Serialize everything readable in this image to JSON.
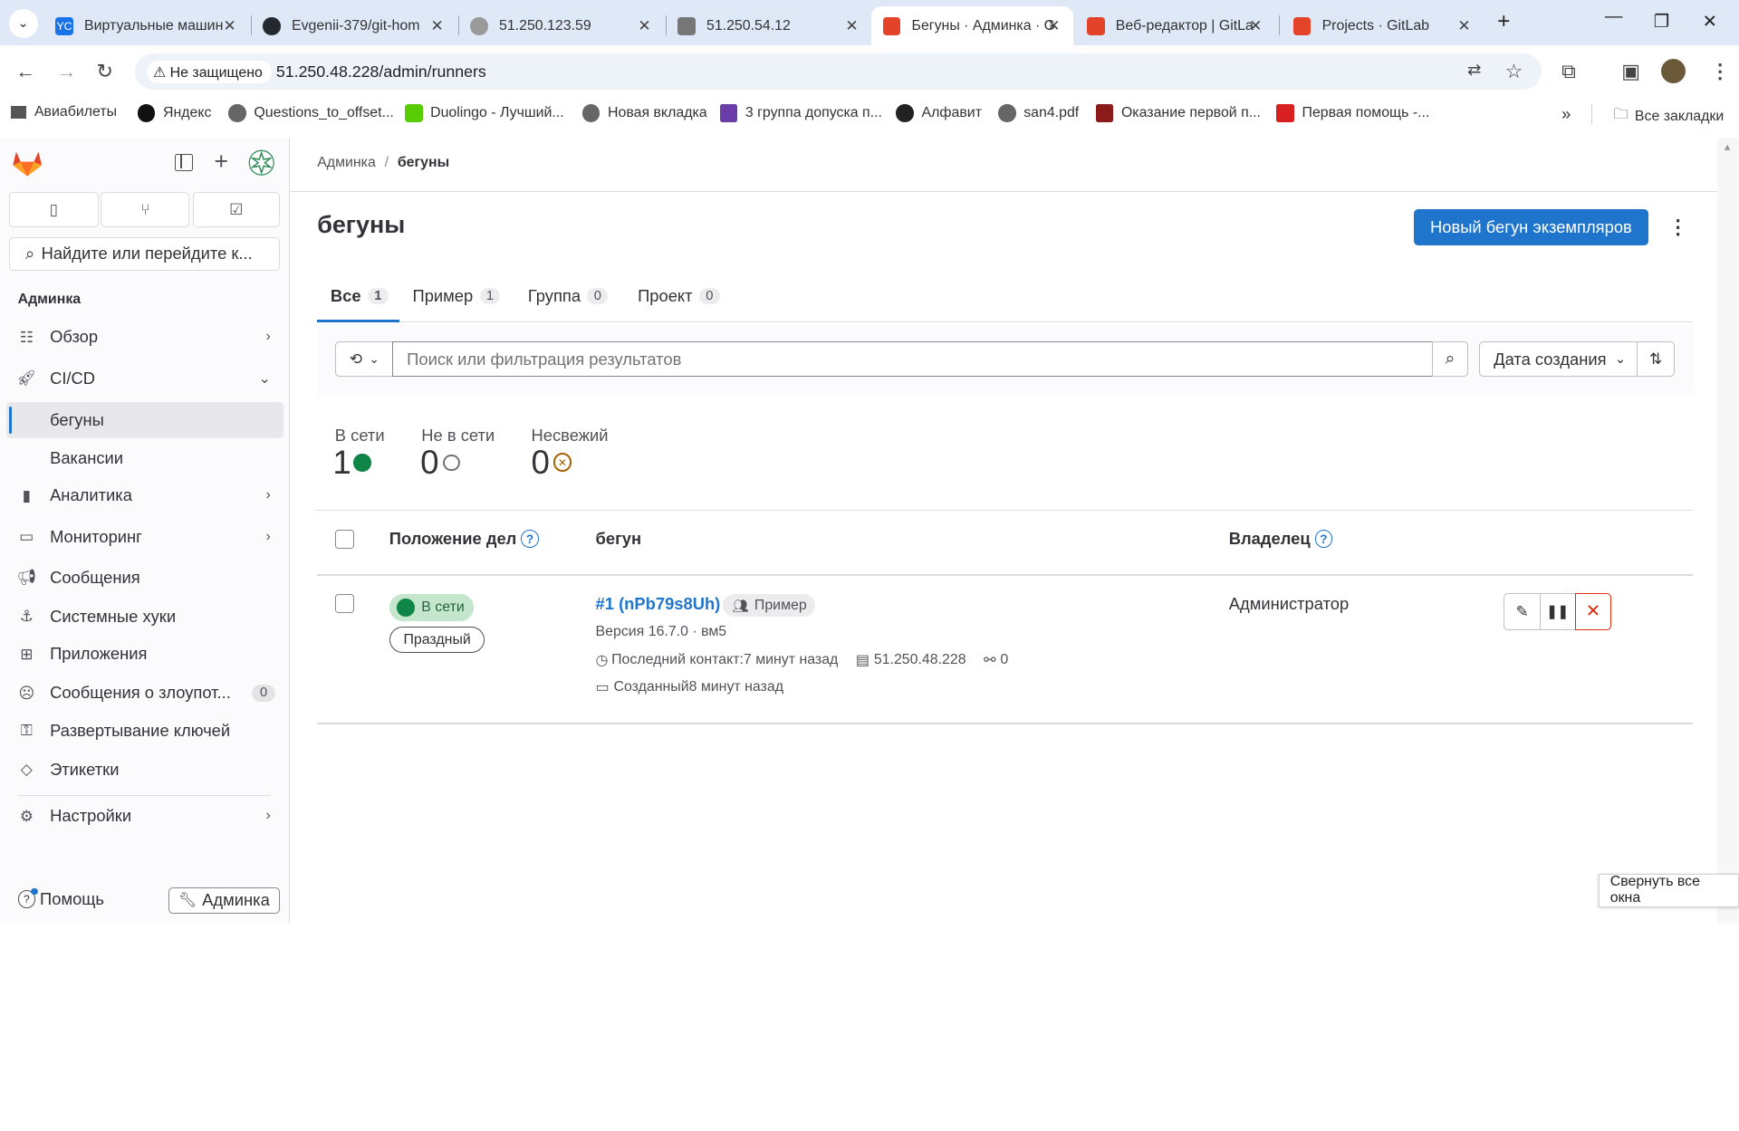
{
  "browser": {
    "tabs": [
      {
        "title": "Виртуальные машин",
        "fav": "YC",
        "color": "#1a73e8"
      },
      {
        "title": "Evgenii-379/git-hom",
        "fav": "",
        "color": "#24292f"
      },
      {
        "title": "51.250.123.59",
        "fav": "",
        "color": "#8a8a8a"
      },
      {
        "title": "51.250.54.12",
        "fav": "",
        "color": "#666"
      },
      {
        "title": "Бегуны · Админка · G",
        "fav": "",
        "color": "#e24329"
      },
      {
        "title": "Веб-редактор | GitLa",
        "fav": "",
        "color": "#e24329"
      },
      {
        "title": "Projects · GitLab",
        "fav": "",
        "color": "#e24329"
      }
    ],
    "security": "Не защищено",
    "url": "51.250.48.228/admin/runners",
    "bookmarks": [
      "Авиабилеты",
      "Яндекс",
      "Questions_to_offset...",
      "Duolingo - Лучший...",
      "Новая вкладка",
      "3 группа допуска п...",
      "Алфавит",
      "san4.pdf",
      "Оказание первой п...",
      "Первая помощь -..."
    ],
    "all_bookmarks": "Все закладки"
  },
  "sidebar": {
    "search_placeholder": "Найдите или перейдите к...",
    "section": "Админка",
    "items": [
      {
        "label": "Обзор",
        "icon": "overview-icon"
      },
      {
        "label": "CI/CD",
        "icon": "rocket-icon"
      },
      {
        "label": "бегуны",
        "icon": ""
      },
      {
        "label": "Вакансии",
        "icon": ""
      },
      {
        "label": "Аналитика",
        "icon": "chart-icon"
      },
      {
        "label": "Мониторинг",
        "icon": "monitor-icon"
      },
      {
        "label": "Сообщения",
        "icon": "bullhorn-icon"
      },
      {
        "label": "Системные хуки",
        "icon": "hook-icon"
      },
      {
        "label": "Приложения",
        "icon": "apps-icon"
      },
      {
        "label": "Сообщения о злоупот...",
        "icon": "abuse-icon",
        "count": "0"
      },
      {
        "label": "Развертывание ключей",
        "icon": "key-icon"
      },
      {
        "label": "Этикетки",
        "icon": "label-icon"
      },
      {
        "label": "Настройки",
        "icon": "gear-icon"
      }
    ],
    "help": "Помощь",
    "admin": "Админка"
  },
  "main": {
    "breadcrumb_root": "Админка",
    "breadcrumb_current": "бегуны",
    "title": "бегуны",
    "new_runner_button": "Новый бегун экземпляров",
    "tabs": [
      {
        "label": "Все",
        "count": "1"
      },
      {
        "label": "Пример",
        "count": "1"
      },
      {
        "label": "Группа",
        "count": "0"
      },
      {
        "label": "Проект",
        "count": "0"
      }
    ],
    "filter_placeholder": "Поиск или фильтрация результатов",
    "sort_label": "Дата создания",
    "stats": [
      {
        "label": "В сети",
        "value": "1"
      },
      {
        "label": "Не в сети",
        "value": "0"
      },
      {
        "label": "Несвежий",
        "value": "0"
      }
    ],
    "table_headers": {
      "status": "Положение дел",
      "runner": "бегун",
      "owner": "Владелец"
    },
    "runner": {
      "status": "В сети",
      "state": "Праздный",
      "name": "#1 (nPb79s8Uh)",
      "type": "Пример",
      "version": "Версия 16.7.0 · вм5",
      "last_contact": "Последний контакт:7 минут назад",
      "ip": "51.250.48.228",
      "jobs": "0",
      "created": "Созданный8 минут назад",
      "owner": "Администратор"
    }
  },
  "tooltip": "Свернуть все окна"
}
